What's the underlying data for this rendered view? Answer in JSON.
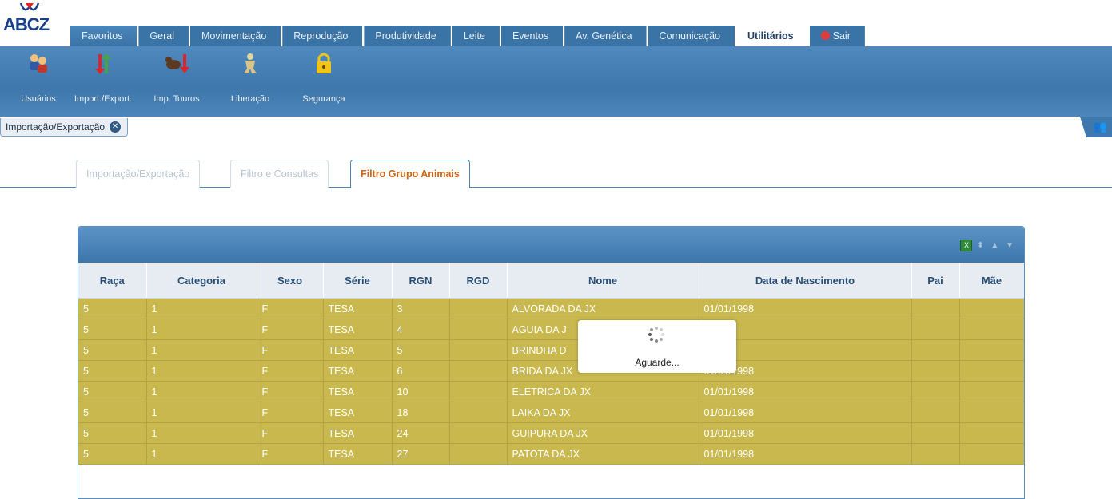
{
  "logo": {
    "text": "ABCZ"
  },
  "menu": [
    {
      "label": "Favoritos"
    },
    {
      "label": "Geral"
    },
    {
      "label": "Movimentação"
    },
    {
      "label": "Reprodução"
    },
    {
      "label": "Produtividade"
    },
    {
      "label": "Leite"
    },
    {
      "label": "Eventos"
    },
    {
      "label": "Av. Genética"
    },
    {
      "label": "Comunicação"
    },
    {
      "label": "Utilitários"
    },
    {
      "label": "Sair"
    }
  ],
  "active_menu": "Utilitários",
  "toolbar": [
    {
      "label": "Usuários",
      "icon": "users-icon"
    },
    {
      "label": "Import./Export.",
      "icon": "import-export-icon"
    },
    {
      "label": "Imp. Touros",
      "icon": "import-bulls-icon"
    },
    {
      "label": "Liberação",
      "icon": "release-icon"
    },
    {
      "label": "Segurança",
      "icon": "lock-icon"
    }
  ],
  "page_tab": {
    "label": "Importação/Exportação"
  },
  "subtabs": [
    {
      "label": "Importação/Exportação"
    },
    {
      "label": "Filtro e Consultas"
    },
    {
      "label": "Filtro Grupo Animais"
    }
  ],
  "active_subtab": "Filtro Grupo Animais",
  "table": {
    "columns": [
      "Raça",
      "Categoria",
      "Sexo",
      "Série",
      "RGN",
      "RGD",
      "Nome",
      "Data de Nascimento",
      "Pai",
      "Mãe"
    ],
    "rows": [
      [
        "5",
        "1",
        "F",
        "TESA",
        "3",
        "",
        "ALVORADA DA JX",
        "01/01/1998",
        "",
        ""
      ],
      [
        "5",
        "1",
        "F",
        "TESA",
        "4",
        "",
        "AGUIA DA J",
        "/1998",
        "",
        ""
      ],
      [
        "5",
        "1",
        "F",
        "TESA",
        "5",
        "",
        "BRINDHA D",
        "/1998",
        "",
        ""
      ],
      [
        "5",
        "1",
        "F",
        "TESA",
        "6",
        "",
        "BRIDA DA JX",
        "01/01/1998",
        "",
        ""
      ],
      [
        "5",
        "1",
        "F",
        "TESA",
        "10",
        "",
        "ELETRICA DA JX",
        "01/01/1998",
        "",
        ""
      ],
      [
        "5",
        "1",
        "F",
        "TESA",
        "18",
        "",
        "LAIKA DA JX",
        "01/01/1998",
        "",
        ""
      ],
      [
        "5",
        "1",
        "F",
        "TESA",
        "24",
        "",
        "GUIPURA DA JX",
        "01/01/1998",
        "",
        ""
      ],
      [
        "5",
        "1",
        "F",
        "TESA",
        "27",
        "",
        "PATOTA DA JX",
        "01/01/1998",
        "",
        ""
      ]
    ]
  },
  "loader": {
    "text": "Aguarde..."
  },
  "colors": {
    "ribbon": "#3d77ab",
    "row": "#c8b84d",
    "active_tab": "#d06416"
  }
}
